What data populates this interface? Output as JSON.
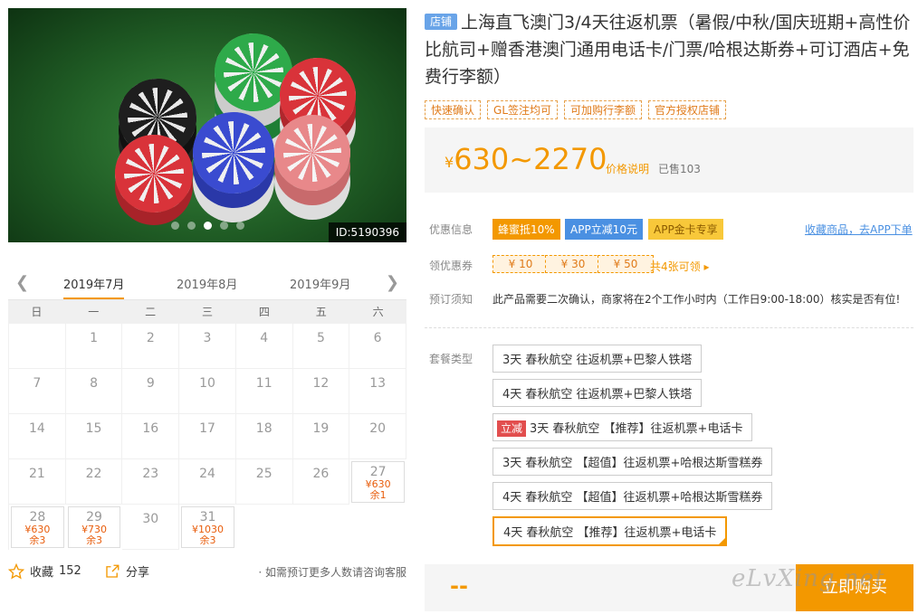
{
  "gallery": {
    "image_id": "ID:5190396",
    "dot_count": 5,
    "active_dot": 2
  },
  "calendar": {
    "months": [
      "2019年7月",
      "2019年8月",
      "2019年9月"
    ],
    "weekdays": [
      "日",
      "一",
      "二",
      "三",
      "四",
      "五",
      "六"
    ],
    "days": [
      {
        "d": ""
      },
      {
        "d": "1"
      },
      {
        "d": "2"
      },
      {
        "d": "3"
      },
      {
        "d": "4"
      },
      {
        "d": "5"
      },
      {
        "d": "6"
      },
      {
        "d": "7"
      },
      {
        "d": "8"
      },
      {
        "d": "9"
      },
      {
        "d": "10"
      },
      {
        "d": "11"
      },
      {
        "d": "12"
      },
      {
        "d": "13"
      },
      {
        "d": "14"
      },
      {
        "d": "15"
      },
      {
        "d": "16"
      },
      {
        "d": "17"
      },
      {
        "d": "18"
      },
      {
        "d": "19"
      },
      {
        "d": "20"
      },
      {
        "d": "21"
      },
      {
        "d": "22"
      },
      {
        "d": "23"
      },
      {
        "d": "24"
      },
      {
        "d": "25"
      },
      {
        "d": "26"
      },
      {
        "d": "27",
        "p": "¥630",
        "r": "余1"
      },
      {
        "d": "28",
        "p": "¥630",
        "r": "余3"
      },
      {
        "d": "29",
        "p": "¥730",
        "r": "余3"
      },
      {
        "d": "30"
      },
      {
        "d": "31",
        "p": "¥1030",
        "r": "余3"
      }
    ]
  },
  "footer": {
    "fav_label": "收藏",
    "fav_count": "152",
    "share_label": "分享",
    "note": "· 如需预订更多人数请咨询客服"
  },
  "product": {
    "shop_tag": "店铺",
    "title": "上海直飞澳门3/4天往返机票（暑假/中秋/国庆班期+高性价比航司+赠香港澳门通用电话卡/门票/哈根达斯券+可订酒店+免费行李额）",
    "tags": [
      "快速确认",
      "GL签注均可",
      "可加购行李额",
      "官方授权店铺"
    ],
    "price_yen": "¥",
    "price_range": "630~2270",
    "price_explain": "价格说明",
    "sold": "已售103"
  },
  "promos": {
    "label": "优惠信息",
    "items": [
      "蜂蜜抵10%",
      "APP立减10元",
      "APP金卡专享"
    ],
    "app_link": "收藏商品，去APP下单"
  },
  "coupons": {
    "label": "领优惠券",
    "items": [
      "¥ 10",
      "¥ 30",
      "¥ 50"
    ],
    "all": "共4张可领 ▸"
  },
  "order": {
    "label": "预订须知",
    "text": "此产品需要二次确认，商家将在2个工作小时内（工作日9:00-18:00）核实是否有位!"
  },
  "packages": {
    "label": "套餐类型",
    "discount_tag": "立减",
    "items": [
      "3天 春秋航空 往返机票+巴黎人铁塔",
      "4天 春秋航空 往返机票+巴黎人铁塔",
      "3天 春秋航空 【推荐】往返机票+电话卡",
      "3天 春秋航空 【超值】往返机票+哈根达斯雪糕券",
      "4天 春秋航空 【超值】往返机票+哈根达斯雪糕券",
      "4天 春秋航空 【推荐】往返机票+电话卡"
    ]
  },
  "buy": {
    "total": "--",
    "button": "立即购买"
  },
  "watermark": "eLvXing.net",
  "colors": {
    "accent": "#f39800",
    "link": "#4a90e2"
  }
}
